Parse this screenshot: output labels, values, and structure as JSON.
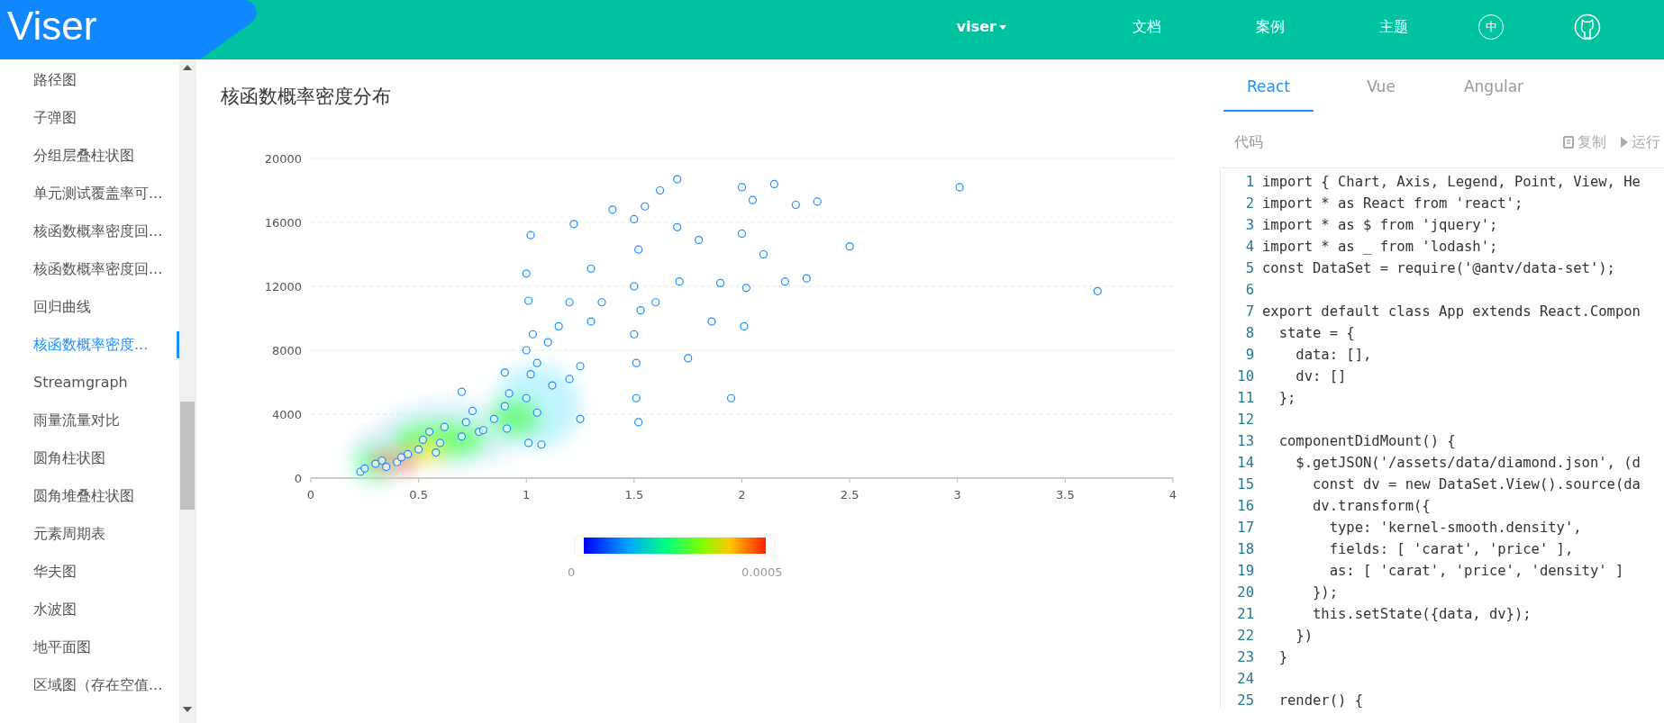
{
  "header": {
    "logo": "Viser",
    "nav": [
      {
        "label": "viser",
        "dropdown": true
      },
      {
        "label": "文档",
        "dropdown": false
      },
      {
        "label": "案例",
        "dropdown": false
      },
      {
        "label": "主题",
        "dropdown": false
      }
    ],
    "language": "中"
  },
  "sidebar": {
    "items": [
      {
        "label": "路径图",
        "selected": false
      },
      {
        "label": "子弹图",
        "selected": false
      },
      {
        "label": "分组层叠柱状图",
        "selected": false
      },
      {
        "label": "单元测试覆盖率可...",
        "selected": false
      },
      {
        "label": "核函数概率密度回...",
        "selected": false
      },
      {
        "label": "核函数概率密度回...",
        "selected": false
      },
      {
        "label": "回归曲线",
        "selected": false
      },
      {
        "label": "核函数概率密度...",
        "selected": true
      },
      {
        "label": "Streamgraph",
        "selected": false
      },
      {
        "label": "雨量流量对比",
        "selected": false
      },
      {
        "label": "圆角柱状图",
        "selected": false
      },
      {
        "label": "圆角堆叠柱状图",
        "selected": false
      },
      {
        "label": "元素周期表",
        "selected": false
      },
      {
        "label": "华夫图",
        "selected": false
      },
      {
        "label": "水波图",
        "selected": false
      },
      {
        "label": "地平面图",
        "selected": false
      },
      {
        "label": "区域图（存在空值...",
        "selected": false
      }
    ]
  },
  "main": {
    "title": "核函数概率密度分布",
    "legend": {
      "min": "0",
      "max": "0.0005"
    },
    "chart_data": {
      "type": "scatter",
      "grid": true,
      "xlim": [
        0,
        4
      ],
      "ylim": [
        0,
        20000
      ],
      "xticks": [
        0,
        0.5,
        1,
        1.5,
        2,
        2.5,
        3,
        3.5,
        4
      ],
      "yticks": [
        0,
        4000,
        8000,
        12000,
        16000,
        20000
      ],
      "x": [
        0.23,
        0.25,
        0.3,
        0.33,
        0.35,
        0.4,
        0.42,
        0.45,
        0.5,
        0.52,
        0.55,
        0.58,
        0.6,
        0.62,
        0.7,
        0.7,
        0.72,
        0.75,
        0.78,
        0.8,
        0.85,
        0.9,
        0.9,
        0.91,
        0.92,
        1.0,
        1.0,
        1.0,
        1.01,
        1.01,
        1.02,
        1.02,
        1.03,
        1.05,
        1.05,
        1.07,
        1.1,
        1.12,
        1.15,
        1.2,
        1.2,
        1.22,
        1.25,
        1.25,
        1.3,
        1.3,
        1.35,
        1.4,
        1.5,
        1.5,
        1.5,
        1.51,
        1.51,
        1.52,
        1.52,
        1.53,
        1.55,
        1.6,
        1.62,
        1.7,
        1.7,
        1.71,
        1.75,
        1.8,
        1.86,
        1.9,
        1.95,
        2.0,
        2.0,
        2.01,
        2.02,
        2.05,
        2.1,
        2.15,
        2.2,
        2.25,
        2.3,
        2.35,
        2.5,
        3.01,
        3.65
      ],
      "series": [
        {
          "color": "#1890ff",
          "values": [
            400,
            600,
            900,
            1100,
            700,
            1000,
            1300,
            1500,
            1800,
            2400,
            2900,
            1600,
            2200,
            3200,
            5400,
            2600,
            3500,
            4200,
            2900,
            3000,
            3700,
            6600,
            4500,
            3100,
            5300,
            12800,
            8000,
            5000,
            11100,
            2200,
            15200,
            6500,
            9000,
            4100,
            7200,
            2100,
            8500,
            5800,
            9500,
            11000,
            6200,
            15900,
            7000,
            3700,
            13100,
            9800,
            11000,
            16800,
            16200,
            12000,
            9000,
            7200,
            5000,
            3500,
            14300,
            10500,
            17000,
            11000,
            18000,
            18700,
            15700,
            12300,
            7500,
            14900,
            9800,
            12200,
            5000,
            18200,
            15300,
            9500,
            11900,
            17400,
            14000,
            18400,
            12300,
            17100,
            12500,
            17300,
            14500,
            18200,
            11700
          ]
        }
      ]
    }
  },
  "code_panel": {
    "tabs": [
      {
        "label": "React",
        "selected": true
      },
      {
        "label": "Vue",
        "selected": false
      },
      {
        "label": "Angular",
        "selected": false
      }
    ],
    "label": "代码",
    "copy": "复制",
    "run": "运行",
    "lines": [
      {
        "number": "1",
        "text": "import { Chart, Axis, Legend, Point, View, He"
      },
      {
        "number": "2",
        "text": "import * as React from 'react';"
      },
      {
        "number": "3",
        "text": "import * as $ from 'jquery';"
      },
      {
        "number": "4",
        "text": "import * as _ from 'lodash';"
      },
      {
        "number": "5",
        "text": "const DataSet = require('@antv/data-set');"
      },
      {
        "number": "6"
      },
      {
        "number": "7",
        "text": "export default class App extends React.Compon"
      },
      {
        "number": "8",
        "text": "  state = {"
      },
      {
        "number": "9",
        "text": "    data: [],"
      },
      {
        "number": "10",
        "text": "    dv: []"
      },
      {
        "number": "11",
        "text": "  };"
      },
      {
        "number": "12"
      },
      {
        "number": "13",
        "text": "  componentDidMount() {"
      },
      {
        "number": "14",
        "text": "    $.getJSON('/assets/data/diamond.json', (d"
      },
      {
        "number": "15",
        "text": "      const dv = new DataSet.View().source(da"
      },
      {
        "number": "16",
        "text": "      dv.transform({"
      },
      {
        "number": "17",
        "text": "        type: 'kernel-smooth.density',"
      },
      {
        "number": "18",
        "text": "        fields: [ 'carat', 'price' ],"
      },
      {
        "number": "19",
        "text": "        as: [ 'carat', 'price', 'density' ]"
      },
      {
        "number": "20",
        "text": "      });"
      },
      {
        "number": "21",
        "text": "      this.setState({data, dv});"
      },
      {
        "number": "22",
        "text": "    })"
      },
      {
        "number": "23",
        "text": "  }"
      },
      {
        "number": "24"
      },
      {
        "number": "25",
        "text": "  render() {"
      }
    ]
  }
}
